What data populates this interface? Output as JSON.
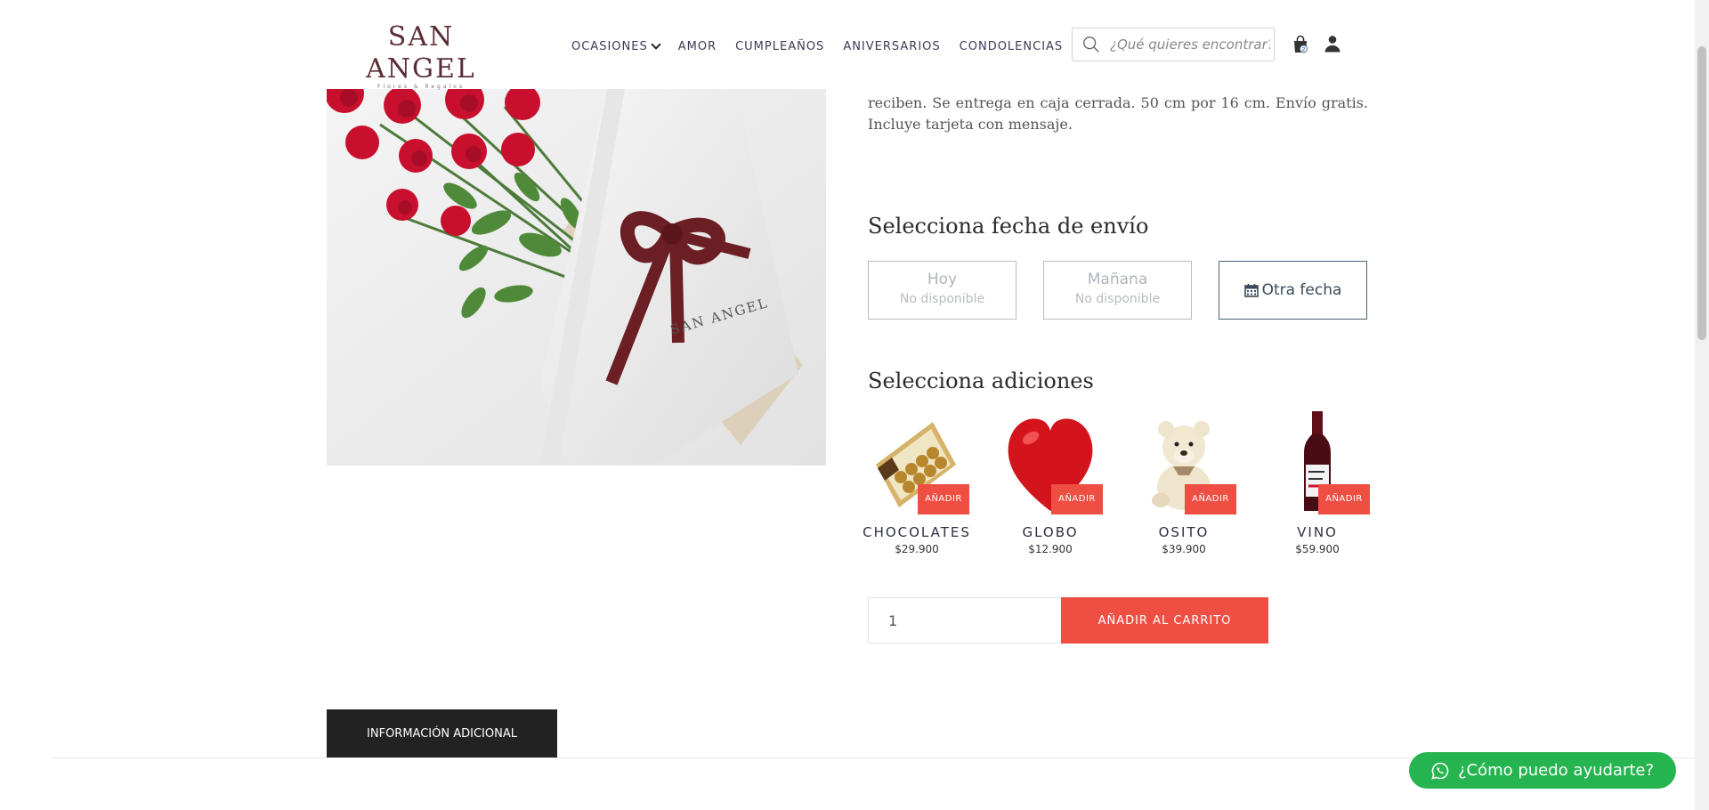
{
  "header": {
    "logo": {
      "main": "SAN ANGEL",
      "sub": "Flores & Regalos"
    },
    "nav": [
      {
        "label": "OCASIONES"
      },
      {
        "label": "AMOR"
      },
      {
        "label": "CUMPLEAÑOS"
      },
      {
        "label": "ANIVERSARIOS"
      },
      {
        "label": "CONDOLENCIAS"
      }
    ],
    "search": {
      "placeholder": "¿Qué quieres encontrar?"
    },
    "cart": {
      "count": "2"
    }
  },
  "product": {
    "description": "reciben. Se entrega en caja cerrada. 50 cm por 16 cm. Envío gratis. Incluye tarjeta con mensaje.",
    "image_label": "SAN ANGEL"
  },
  "delivery": {
    "title": "Selecciona fecha de envío",
    "options": [
      {
        "label": "Hoy",
        "status": "No disponible"
      },
      {
        "label": "Mañana",
        "status": "No disponible"
      },
      {
        "label": "Otra fecha"
      }
    ]
  },
  "addons": {
    "title": "Selecciona adiciones",
    "button_label": "AÑADIR",
    "items": [
      {
        "name": "CHOCOLATES",
        "price": "$29.900"
      },
      {
        "name": "GLOBO",
        "price": "$12.900"
      },
      {
        "name": "OSITO",
        "price": "$39.900"
      },
      {
        "name": "VINO",
        "price": "$59.900"
      }
    ]
  },
  "cart_form": {
    "quantity": "1",
    "add_label": "AÑADIR AL CARRITO"
  },
  "tabs": {
    "info_label": "INFORMACIÓN ADICIONAL"
  },
  "whatsapp": {
    "label": "¿Cómo puedo ayudarte?"
  },
  "colors": {
    "accent": "#ef4e43",
    "whatsapp": "#25b44f",
    "brand": "#5a2e35",
    "dark": "#222222"
  }
}
